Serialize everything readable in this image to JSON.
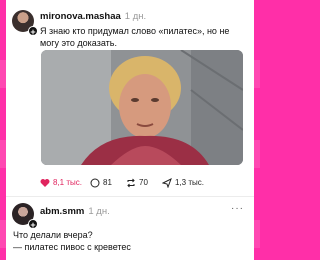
{
  "posts": [
    {
      "username": "mironova.mashaa",
      "time": "1 дн.",
      "text": "Я знаю кто придумал слово «пилатес», но не могу это доказать.",
      "stats": {
        "likes": "8,1 тыс.",
        "comments": "81",
        "reposts": "70",
        "shares": "1,3 тыс."
      }
    },
    {
      "username": "abm.smm",
      "time": "1 дн.",
      "text_line1": "Что делали вчера?",
      "text_line2": "— пилатес пивос с креветес"
    }
  ],
  "colors": {
    "background": "#ff2fa8",
    "like": "#e0245e",
    "card": "#ffffff"
  },
  "icons": {
    "like": "heart-icon",
    "comment": "comment-icon",
    "repost": "repost-icon",
    "share": "send-icon",
    "more": "more-icon"
  }
}
